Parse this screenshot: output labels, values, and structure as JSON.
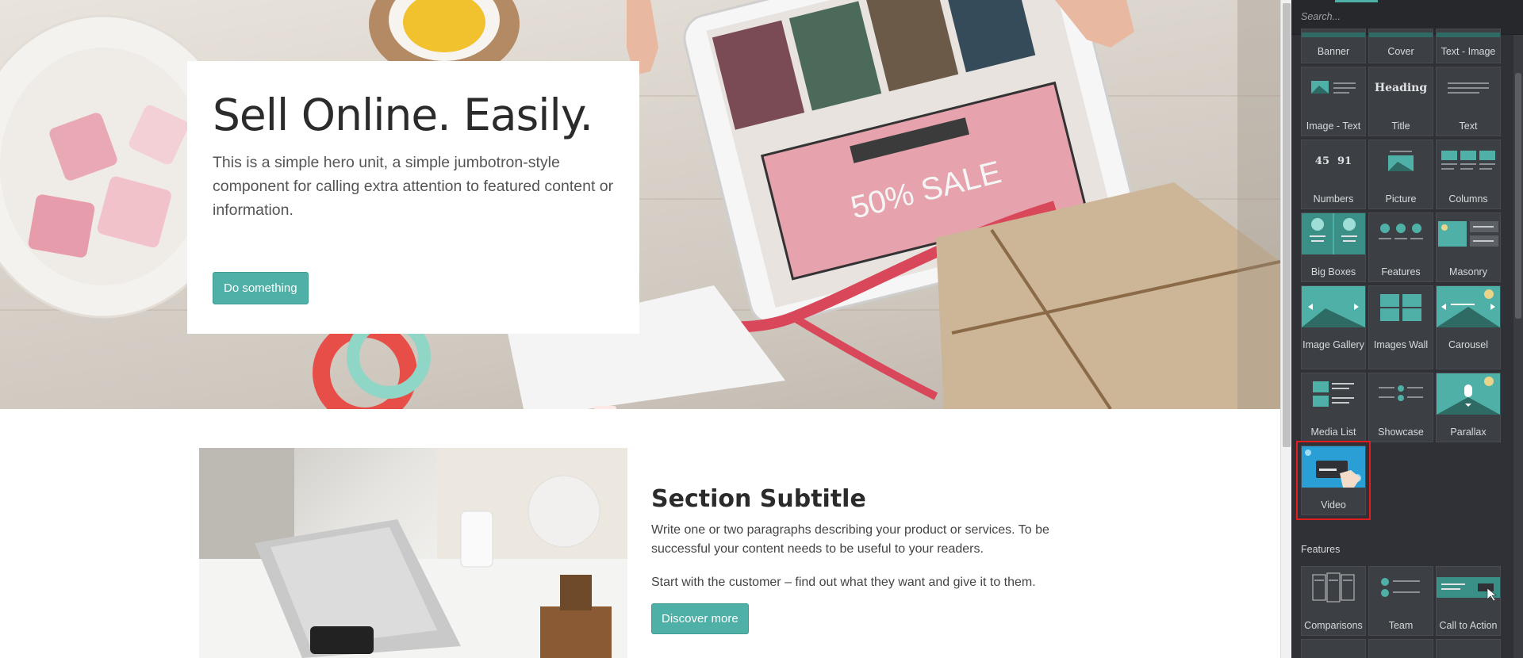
{
  "hero": {
    "title": "Sell Online. Easily.",
    "text": "This is a simple hero unit, a simple jumbotron-style component for calling extra attention to featured content or information.",
    "button": "Do something"
  },
  "section": {
    "subtitle": "Section Subtitle",
    "paragraph1": "Write one or two paragraphs describing your product or services. To be successful your content needs to be useful to your readers.",
    "paragraph2": "Start with the customer – find out what they want and give it to them.",
    "button": "Discover more"
  },
  "sidebar": {
    "search_placeholder": "Search...",
    "structure": [
      {
        "label": "Banner",
        "icon": "banner-icon"
      },
      {
        "label": "Cover",
        "icon": "cover-icon"
      },
      {
        "label": "Text - Image",
        "icon": "text-image-icon"
      },
      {
        "label": "Image - Text",
        "icon": "image-text-icon"
      },
      {
        "label": "Title",
        "icon": "title-icon",
        "thumb_text": "Heading"
      },
      {
        "label": "Text",
        "icon": "text-icon"
      },
      {
        "label": "Numbers",
        "icon": "numbers-icon",
        "thumb_text_a": "45",
        "thumb_text_b": "91"
      },
      {
        "label": "Picture",
        "icon": "picture-icon"
      },
      {
        "label": "Columns",
        "icon": "columns-icon"
      },
      {
        "label": "Big Boxes",
        "icon": "big-boxes-icon"
      },
      {
        "label": "Features",
        "icon": "features-icon"
      },
      {
        "label": "Masonry",
        "icon": "masonry-icon"
      },
      {
        "label": "Image Gallery",
        "icon": "image-gallery-icon"
      },
      {
        "label": "Images Wall",
        "icon": "images-wall-icon"
      },
      {
        "label": "Carousel",
        "icon": "carousel-icon"
      },
      {
        "label": "Media List",
        "icon": "media-list-icon"
      },
      {
        "label": "Showcase",
        "icon": "showcase-icon"
      },
      {
        "label": "Parallax",
        "icon": "parallax-icon"
      },
      {
        "label": "Video",
        "icon": "video-icon",
        "selected": true
      }
    ],
    "features_title": "Features",
    "features": [
      {
        "label": "Comparisons",
        "icon": "comparisons-icon"
      },
      {
        "label": "Team",
        "icon": "team-icon"
      },
      {
        "label": "Call to Action",
        "icon": "call-to-action-icon"
      }
    ]
  },
  "colors": {
    "accent": "#4fb0a7",
    "sidebar_bg": "#2f3136",
    "selection": "#e11d1d"
  }
}
